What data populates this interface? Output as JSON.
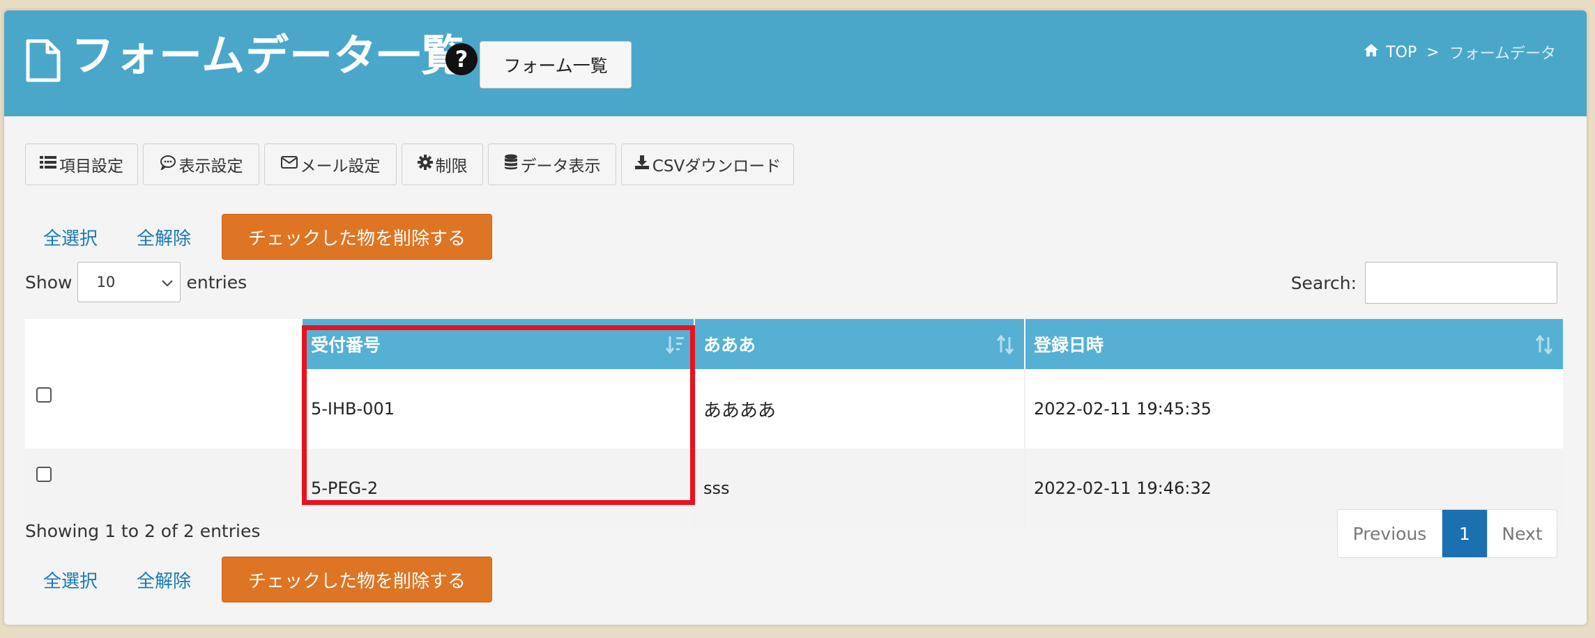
{
  "header": {
    "title": "フォームデータ一覧",
    "form_list_button": "フォーム一覧",
    "breadcrumb": {
      "home": "TOP",
      "separator": ">",
      "current": "フォームデータ"
    }
  },
  "toolbar": {
    "items": [
      {
        "label": "項目設定",
        "icon": "list-icon"
      },
      {
        "label": "表示設定",
        "icon": "comment-icon"
      },
      {
        "label": "メール設定",
        "icon": "envelope-icon"
      },
      {
        "label": "制限",
        "icon": "gear-icon"
      },
      {
        "label": "データ表示",
        "icon": "database-icon"
      },
      {
        "label": "CSVダウンロード",
        "icon": "download-icon"
      }
    ]
  },
  "selection": {
    "select_all": "全選択",
    "deselect_all": "全解除",
    "delete_checked": "チェックした物を削除する"
  },
  "length": {
    "show": "Show",
    "value": "10",
    "entries": "entries"
  },
  "search": {
    "label": "Search:",
    "value": ""
  },
  "table": {
    "columns": [
      "",
      "受付番号",
      "あああ",
      "登録日時"
    ],
    "rows": [
      {
        "checked": false,
        "number": "5-IHB-001",
        "field": "ああああ",
        "date": "2022-02-11 19:45:35"
      },
      {
        "checked": false,
        "number": "5-PEG-2",
        "field": "sss",
        "date": "2022-02-11 19:46:32"
      }
    ]
  },
  "info": "Showing 1 to 2 of 2 entries",
  "pagination": {
    "previous": "Previous",
    "current": "1",
    "next": "Next"
  },
  "colors": {
    "header_bg": "#4ba7c9",
    "table_header_bg": "#55b0d3",
    "delete_button": "#de7524",
    "highlight": "#e8121e",
    "pager_active": "#1b70b2",
    "link": "#1a7ab8"
  }
}
